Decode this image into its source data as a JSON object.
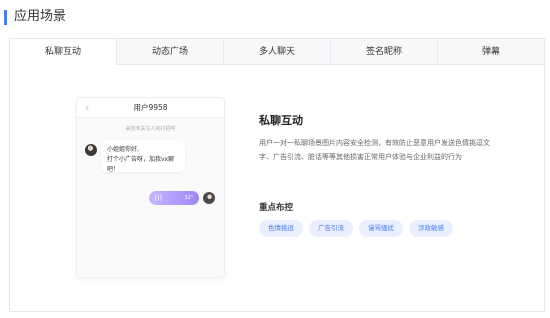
{
  "section": {
    "title": "应用场景"
  },
  "tabs": [
    {
      "label": "私聊互动",
      "active": true
    },
    {
      "label": "动态广场",
      "active": false
    },
    {
      "label": "多人聊天",
      "active": false
    },
    {
      "label": "签名昵称",
      "active": false
    },
    {
      "label": "弹幕",
      "active": false
    }
  ],
  "phone": {
    "title": "用户9958",
    "hint": "来自未关注人的打招呼",
    "message_line1": "小姐姐你好,",
    "message_line2": "打个小广告呀，加我vx聊吧！",
    "voice_length": "32\""
  },
  "detail": {
    "title": "私聊互动",
    "description": "用户一对一私聊场景图片内容安全检测，有效防止恶意用户发送色情挑逗文字、广告引流、脏话等等其他损害正常用户体验与企业利益的行为",
    "controls_title": "重点布控",
    "tags": [
      "色情挑逗",
      "广告引流",
      "谩骂骚扰",
      "涉政敏感"
    ]
  },
  "colors": {
    "accent": "#4a7cf6",
    "tag_bg": "#e9efff",
    "voice_gradient_start": "#c6b6ff",
    "voice_gradient_end": "#9f86f7"
  },
  "icons": {
    "back": "chevron-left-icon",
    "voice": "voice-wave-icon"
  }
}
